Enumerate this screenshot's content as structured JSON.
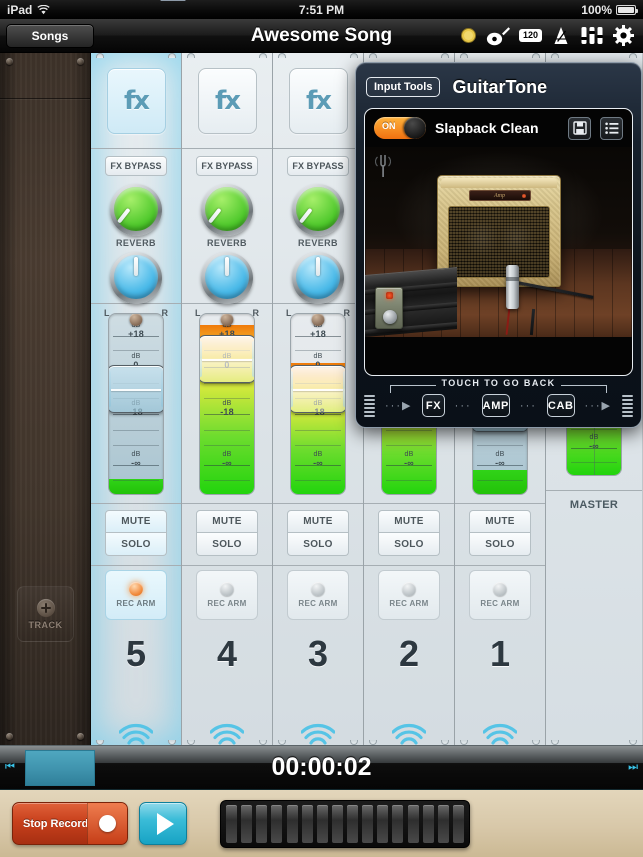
{
  "status_bar": {
    "device": "iPad",
    "wifi_icon": "wifi-icon",
    "time": "7:51 PM",
    "battery_percent": "100%"
  },
  "nav_bar": {
    "back_label": "Songs",
    "title": "Awesome Song",
    "icons": [
      {
        "name": "metronome-light-icon",
        "glyph": "●"
      },
      {
        "name": "guitar-icon",
        "glyph": "guitar"
      },
      {
        "name": "tempo-icon",
        "value": "120"
      },
      {
        "name": "metronome-icon",
        "glyph": "metronome"
      },
      {
        "name": "mixer-faders-icon",
        "glyph": "faders"
      },
      {
        "name": "settings-gear-icon",
        "glyph": "gear"
      }
    ]
  },
  "sidebar": {
    "add_track_label": "TRACK"
  },
  "mixer": {
    "fx_glyph": "fx",
    "fx_bypass_label": "FX BYPASS",
    "reverb_label": "REVERB",
    "pan_left_label": "L",
    "pan_right_label": "R",
    "mute_label": "MUTE",
    "solo_label": "SOLO",
    "rec_arm_label": "REC ARM",
    "master_label": "MASTER",
    "scale_labels": {
      "top": "+18",
      "mid": "0",
      "low": "-18",
      "bottom": "-∞",
      "unit": "dB"
    },
    "channels": [
      {
        "number": "5",
        "selected": true,
        "fader_pct": 62,
        "meter_pct": 8,
        "cold": true
      },
      {
        "number": "4",
        "selected": false,
        "fader_pct": 84,
        "meter_pct": 93,
        "cold": false
      },
      {
        "number": "3",
        "selected": false,
        "fader_pct": 62,
        "meter_pct": 72,
        "cold": false
      },
      {
        "number": "2",
        "selected": false,
        "fader_pct": 62,
        "meter_pct": 67,
        "cold": false
      },
      {
        "number": "1",
        "selected": false,
        "fader_pct": 48,
        "meter_pct": 13,
        "cold": true
      },
      {
        "number": "",
        "selected": false,
        "fader_pct": 62,
        "meter_pct": 70,
        "cold": false,
        "is_master": true
      }
    ]
  },
  "popover": {
    "input_tools_label": "Input Tools",
    "title": "GuitarTone",
    "toggle_label": "ON",
    "toggle_on": true,
    "preset_name": "Slapback Clean",
    "save_icon": "save-disk-icon",
    "list_icon": "preset-list-icon",
    "amp_brand": "Amp",
    "touch_back_label": "TOUCH TO GO BACK",
    "chain": [
      {
        "label": "FX"
      },
      {
        "label": "AMP"
      },
      {
        "label": "CAB"
      }
    ]
  },
  "transport": {
    "time_display": "00:00:02",
    "jump_start_icon": "jump-to-start-icon",
    "jump_end_icon": "jump-to-end-icon",
    "record_label": "Stop Recording",
    "play_icon": "play-icon",
    "keyboard_icon": "keyboard-icon"
  },
  "colors": {
    "accent_blue": "#3bbcd8",
    "record_red": "#c8401c",
    "toggle_orange": "#f07010",
    "meter_green": "#22d40d",
    "selection_cyan": "#78cdeb"
  }
}
